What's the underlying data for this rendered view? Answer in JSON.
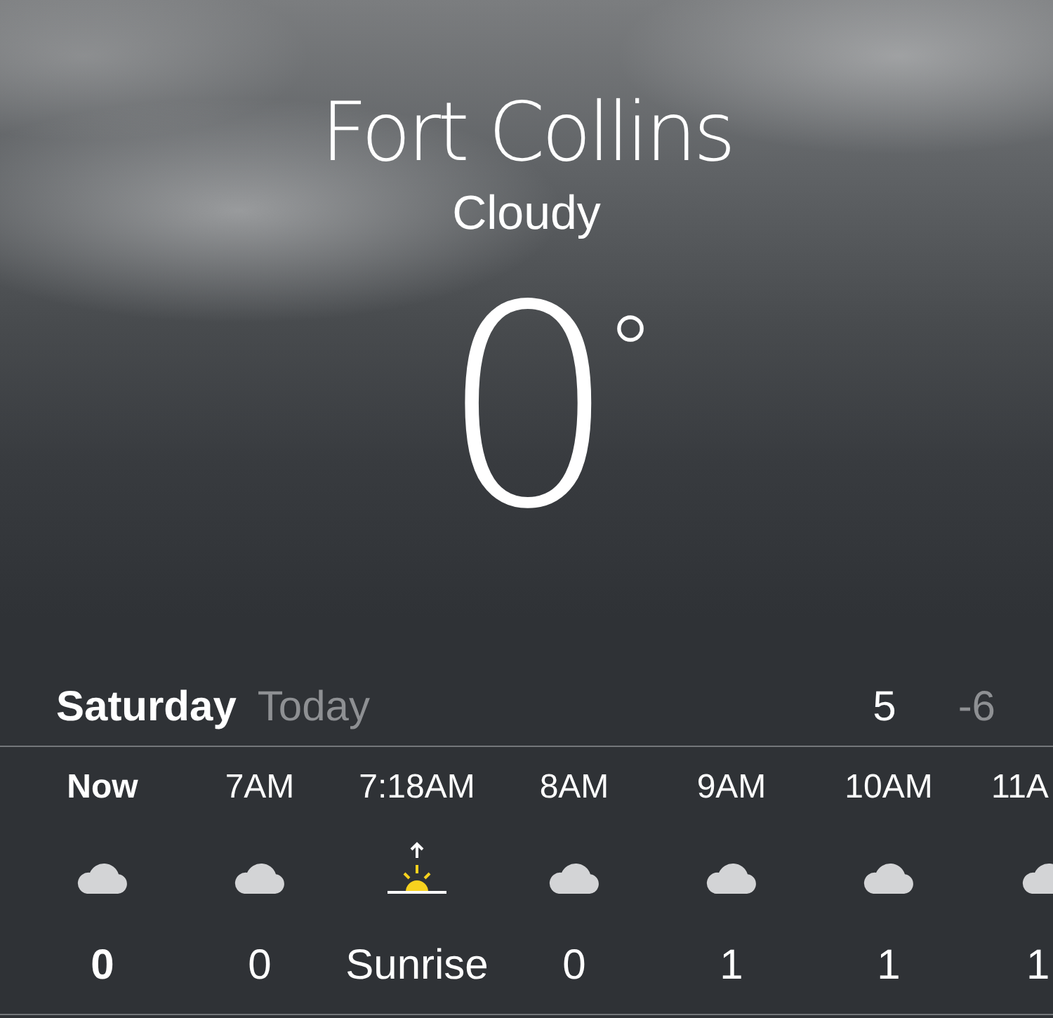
{
  "location": {
    "city": "Fort Collins",
    "condition": "Cloudy",
    "temperature": "0$^{°}$"
  },
  "today": {
    "day": "Saturday",
    "label": "Today",
    "high": "5",
    "low": "-6"
  },
  "hourly": [
    {
      "time": "Now",
      "kind": "cloudy",
      "value": "0",
      "current": true
    },
    {
      "time": "7AM",
      "kind": "cloudy",
      "value": "0",
      "current": false
    },
    {
      "time": "7:18AM",
      "kind": "sunrise",
      "value": "Sunrise",
      "current": false
    },
    {
      "time": "8AM",
      "kind": "cloudy",
      "value": "0",
      "current": false
    },
    {
      "time": "9AM",
      "kind": "cloudy",
      "value": "1",
      "current": false
    },
    {
      "time": "10AM",
      "kind": "cloudy",
      "value": "1",
      "current": false
    },
    {
      "time": "11A",
      "kind": "cloudy",
      "value": "1",
      "current": false
    }
  ]
}
